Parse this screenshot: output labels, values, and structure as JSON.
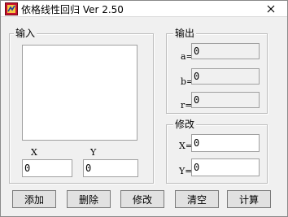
{
  "window": {
    "title": "依格线性回归 Ver 2.50"
  },
  "input_group": {
    "label": "输入",
    "x_label": "X",
    "y_label": "Y",
    "x_value": "0",
    "y_value": "0"
  },
  "output_group": {
    "label": "输出",
    "a_label": "a=",
    "a_value": "0",
    "b_label": "b=",
    "b_value": "0",
    "r_label": "r=",
    "r_value": "0"
  },
  "modify_group": {
    "label": "修改",
    "x_label": "X=",
    "x_value": "0",
    "y_label": "Y=",
    "y_value": "0"
  },
  "buttons": {
    "add": "添加",
    "delete": "删除",
    "modify": "修改",
    "clear": "清空",
    "compute": "计算"
  },
  "icons": {
    "app": "app-icon",
    "close": "close-icon"
  },
  "colors": {
    "window_bg": "#f0f0f0",
    "title_bg": "#ffffff",
    "button_bg": "#e1e1e1"
  }
}
